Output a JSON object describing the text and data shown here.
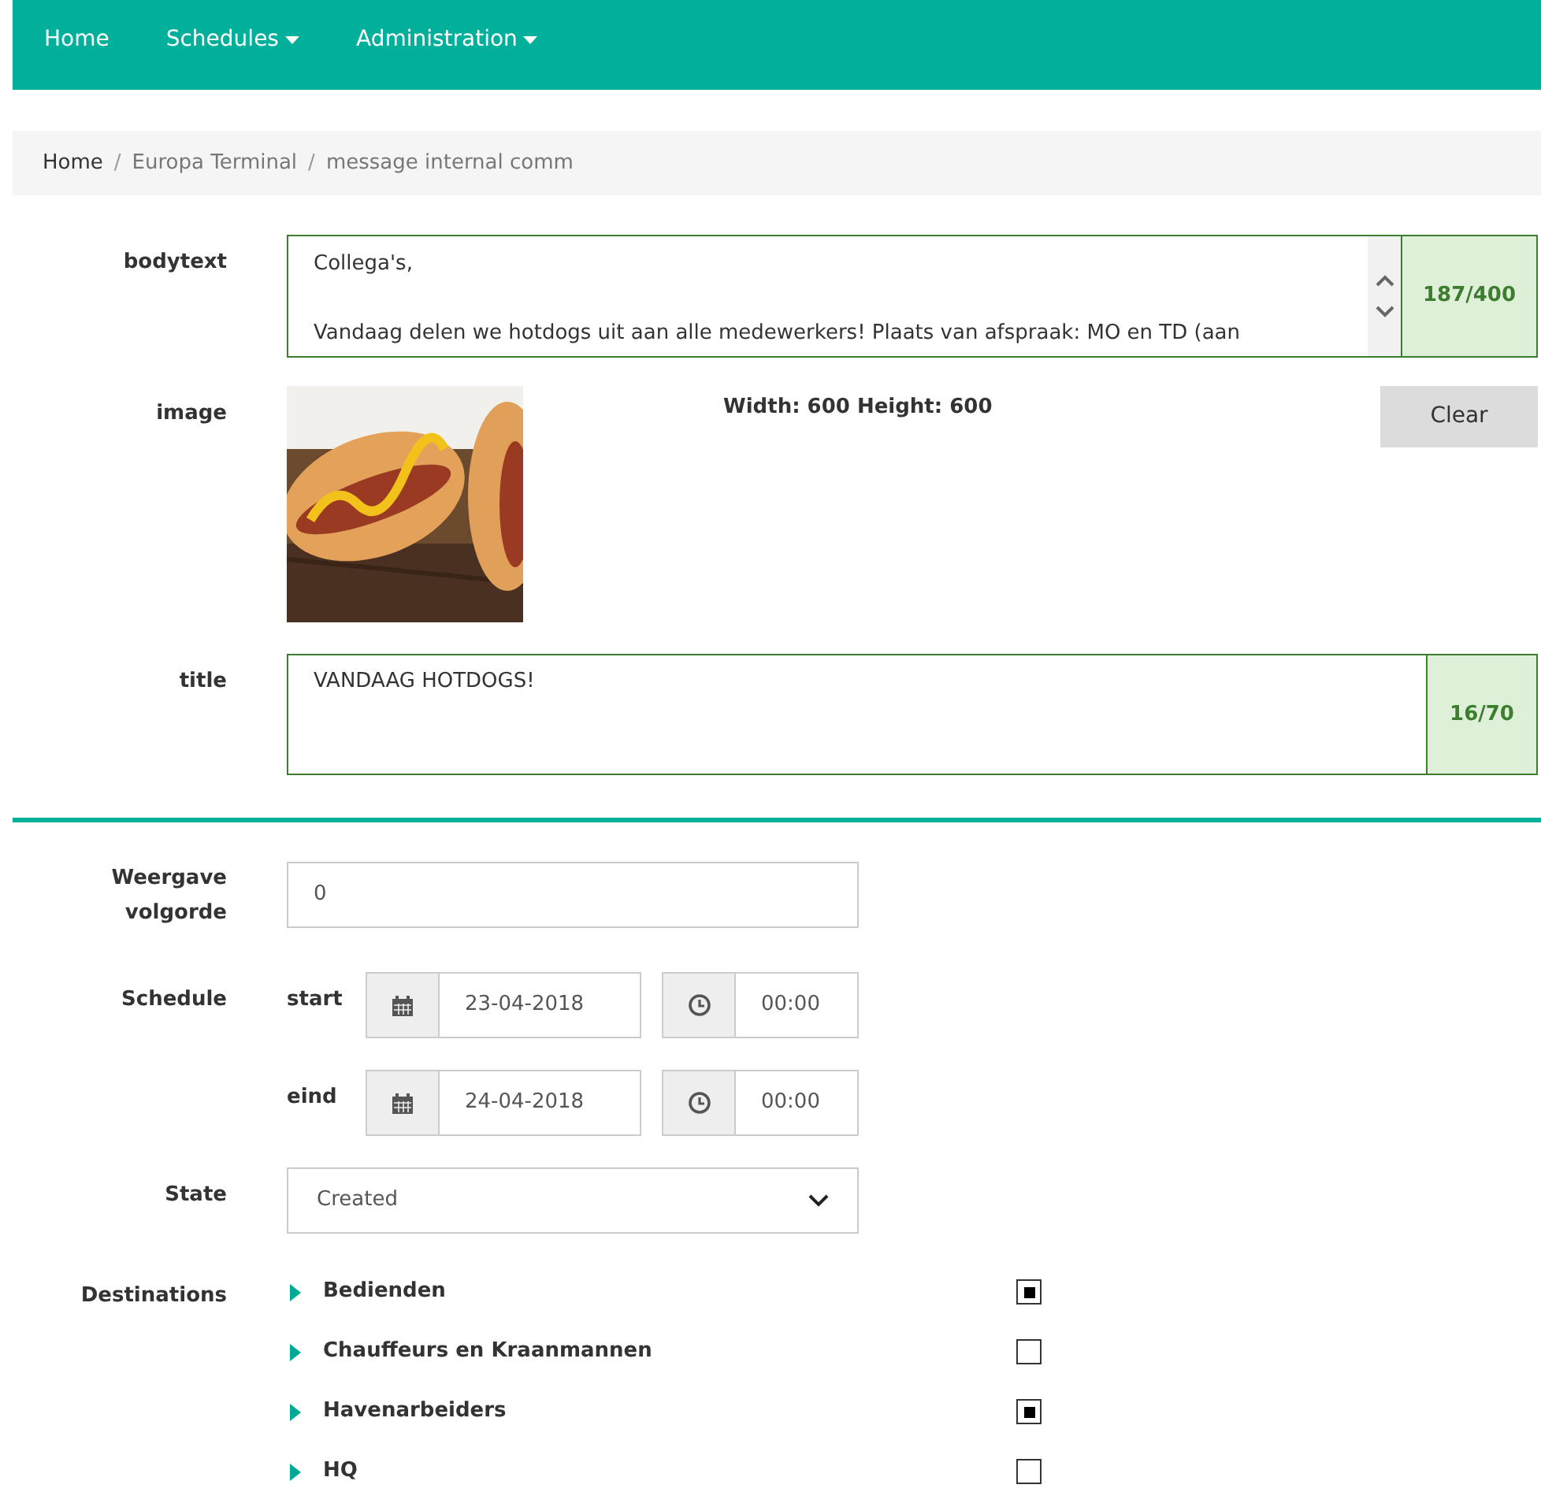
{
  "navbar": {
    "items": [
      {
        "label": "Home",
        "dropdown": false
      },
      {
        "label": "Schedules",
        "dropdown": true
      },
      {
        "label": "Administration",
        "dropdown": true
      }
    ]
  },
  "breadcrumb": {
    "items": [
      "Home",
      "Europa Terminal",
      "message internal comm"
    ],
    "separators": [
      "/",
      "/"
    ]
  },
  "form": {
    "bodytext": {
      "label": "bodytext",
      "value": "Collega's,\n\nVandaag delen we hotdogs uit aan alle medewerkers! Plaats van afspraak: MO en TD (aan",
      "counter": "187/400"
    },
    "image": {
      "label": "image",
      "dimensions": "Width: 600 Height: 600",
      "clear_button": "Clear"
    },
    "title": {
      "label": "title",
      "value": "VANDAAG HOTDOGS!",
      "counter": "16/70"
    },
    "order": {
      "label": "Weergave volgorde",
      "value": "0"
    },
    "schedule": {
      "label": "Schedule",
      "rows": [
        {
          "label": "start",
          "date": "23-04-2018",
          "time": "00:00"
        },
        {
          "label": "eind",
          "date": "24-04-2018",
          "time": "00:00"
        }
      ]
    },
    "state": {
      "label": "State",
      "value": "Created"
    },
    "destinations": {
      "label": "Destinations",
      "items": [
        {
          "label": "Bedienden",
          "checked": true,
          "expanded": false
        },
        {
          "label": "Chauffeurs en Kraanmannen",
          "checked": false,
          "expanded": false
        },
        {
          "label": "Havenarbeiders",
          "checked": true,
          "expanded": false
        },
        {
          "label": "HQ",
          "checked": false,
          "expanded": false
        }
      ]
    }
  }
}
